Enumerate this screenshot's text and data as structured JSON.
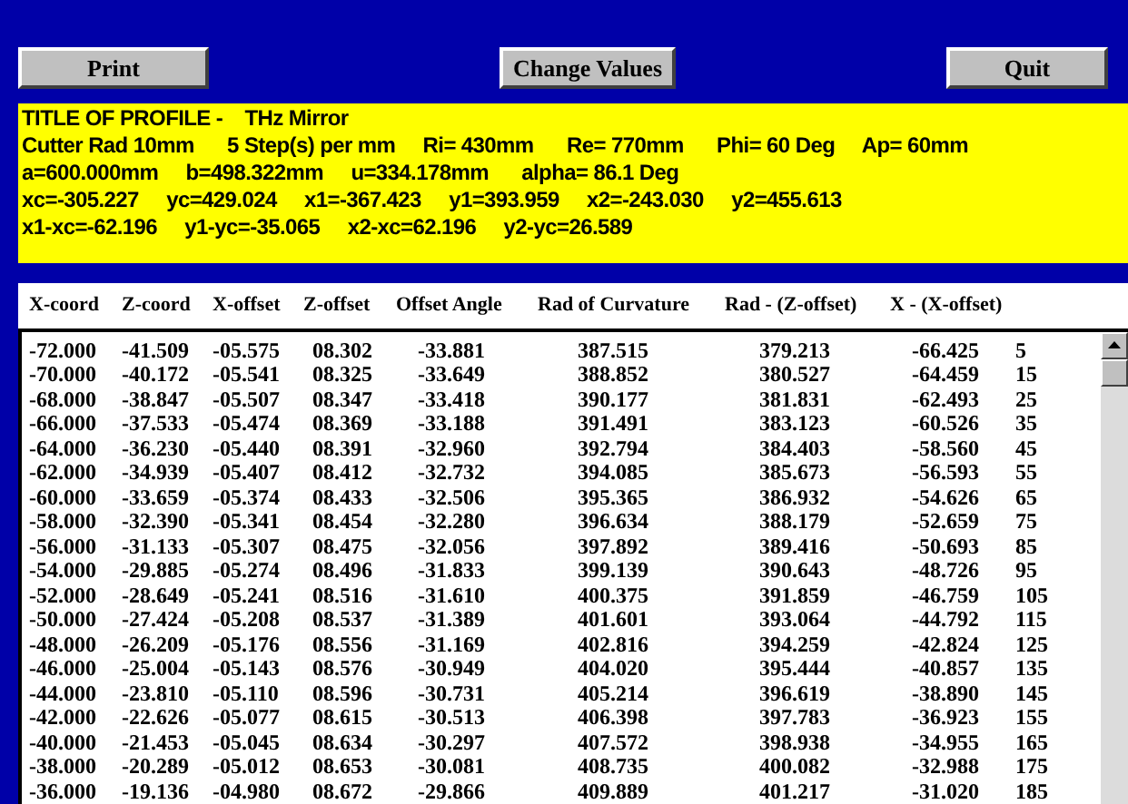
{
  "buttons": [
    "Print",
    "Change Values",
    "Quit"
  ],
  "info_lines": [
    "TITLE OF PROFILE -    THz Mirror",
    "Cutter Rad 10mm      5 Step(s) per mm     Ri= 430mm      Re= 770mm      Phi= 60 Deg     Ap= 60mm",
    "a=600.000mm     b=498.322mm     u=334.178mm      alpha= 86.1 Deg",
    "xc=-305.227     yc=429.024     x1=-367.423     y1=393.959     x2=-243.030     y2=455.613",
    "x1-xc=-62.196     y1-yc=-35.065     x2-xc=62.196     y2-yc=26.589"
  ],
  "table": {
    "columns": [
      "X-coord",
      "Z-coord",
      "X-offset",
      "Z-offset",
      "Offset Angle",
      "Rad of Curvature",
      "Rad - (Z-offset)",
      "X - (X-offset)"
    ],
    "rows": [
      [
        "-72.000",
        "-41.509",
        "-05.575",
        "08.302",
        "-33.881",
        "387.515",
        "379.213",
        "-66.425",
        "5"
      ],
      [
        "-70.000",
        "-40.172",
        "-05.541",
        "08.325",
        "-33.649",
        "388.852",
        "380.527",
        "-64.459",
        "15"
      ],
      [
        "-68.000",
        "-38.847",
        "-05.507",
        "08.347",
        "-33.418",
        "390.177",
        "381.831",
        "-62.493",
        "25"
      ],
      [
        "-66.000",
        "-37.533",
        "-05.474",
        "08.369",
        "-33.188",
        "391.491",
        "383.123",
        "-60.526",
        "35"
      ],
      [
        "-64.000",
        "-36.230",
        "-05.440",
        "08.391",
        "-32.960",
        "392.794",
        "384.403",
        "-58.560",
        "45"
      ],
      [
        "-62.000",
        "-34.939",
        "-05.407",
        "08.412",
        "-32.732",
        "394.085",
        "385.673",
        "-56.593",
        "55"
      ],
      [
        "-60.000",
        "-33.659",
        "-05.374",
        "08.433",
        "-32.506",
        "395.365",
        "386.932",
        "-54.626",
        "65"
      ],
      [
        "-58.000",
        "-32.390",
        "-05.341",
        "08.454",
        "-32.280",
        "396.634",
        "388.179",
        "-52.659",
        "75"
      ],
      [
        "-56.000",
        "-31.133",
        "-05.307",
        "08.475",
        "-32.056",
        "397.892",
        "389.416",
        "-50.693",
        "85"
      ],
      [
        "-54.000",
        "-29.885",
        "-05.274",
        "08.496",
        "-31.833",
        "399.139",
        "390.643",
        "-48.726",
        "95"
      ],
      [
        "-52.000",
        "-28.649",
        "-05.241",
        "08.516",
        "-31.610",
        "400.375",
        "391.859",
        "-46.759",
        "105"
      ],
      [
        "-50.000",
        "-27.424",
        "-05.208",
        "08.537",
        "-31.389",
        "401.601",
        "393.064",
        "-44.792",
        "115"
      ],
      [
        "-48.000",
        "-26.209",
        "-05.176",
        "08.556",
        "-31.169",
        "402.816",
        "394.259",
        "-42.824",
        "125"
      ],
      [
        "-46.000",
        "-25.004",
        "-05.143",
        "08.576",
        "-30.949",
        "404.020",
        "395.444",
        "-40.857",
        "135"
      ],
      [
        "-44.000",
        "-23.810",
        "-05.110",
        "08.596",
        "-30.731",
        "405.214",
        "396.619",
        "-38.890",
        "145"
      ],
      [
        "-42.000",
        "-22.626",
        "-05.077",
        "08.615",
        "-30.513",
        "406.398",
        "397.783",
        "-36.923",
        "155"
      ],
      [
        "-40.000",
        "-21.453",
        "-05.045",
        "08.634",
        "-30.297",
        "407.572",
        "398.938",
        "-34.955",
        "165"
      ],
      [
        "-38.000",
        "-20.289",
        "-05.012",
        "08.653",
        "-30.081",
        "408.735",
        "400.082",
        "-32.988",
        "175"
      ],
      [
        "-36.000",
        "-19.136",
        "-04.980",
        "08.672",
        "-29.866",
        "409.889",
        "401.217",
        "-31.020",
        "185"
      ]
    ]
  }
}
